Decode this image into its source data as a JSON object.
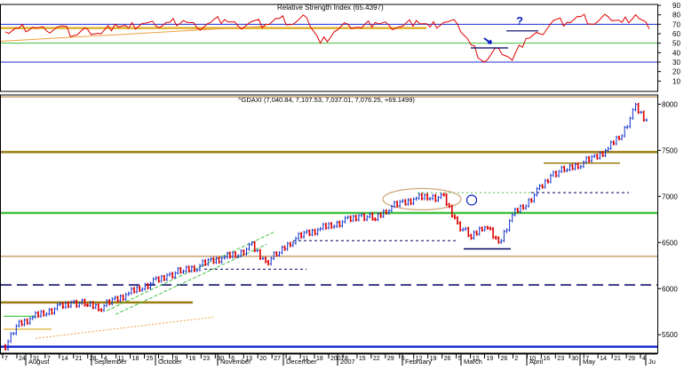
{
  "colors": {
    "background": "#ffffff",
    "frame": "#000000",
    "rsi_line": "#e00000",
    "price_up": "#1030d0",
    "price_down": "#e00000",
    "blue_level": "#1a2fd0",
    "green_level": "#40c040",
    "olive_level": "#9a7d10",
    "tan_level": "#c8a070",
    "orange_trend": "#f0a040",
    "gold_line": "#e0b030",
    "navy_dash": "#000060",
    "annotation_blue": "#1020c0"
  },
  "chart_data": [
    {
      "type": "line",
      "title": "Relative Strength Index (65.4397)",
      "ylim": [
        0,
        90
      ],
      "yticks": [
        "10",
        "20",
        "30",
        "40",
        "50",
        "60",
        "70",
        "80",
        "90"
      ],
      "reference_lines": [
        30,
        50,
        70
      ],
      "annotations": [
        "arrow-icon",
        "question-mark",
        "?"
      ],
      "series": [
        {
          "name": "Relative Strength Index",
          "x_week": [
            0,
            1,
            2,
            3,
            4,
            5,
            6,
            7,
            8,
            9,
            10,
            11,
            12,
            13,
            14,
            15,
            16,
            17,
            18,
            19,
            20,
            21,
            22,
            23,
            24,
            25,
            26,
            27,
            28,
            29,
            30,
            31,
            32,
            33,
            34,
            35,
            36,
            37,
            38,
            39,
            40,
            41,
            42,
            43,
            44,
            45,
            46,
            47
          ],
          "values": [
            62,
            66,
            67,
            63,
            68,
            58,
            65,
            60,
            70,
            66,
            71,
            68,
            72,
            74,
            66,
            72,
            75,
            68,
            73,
            70,
            76,
            70,
            77,
            50,
            62,
            70,
            66,
            72,
            69,
            68,
            74,
            67,
            72,
            70,
            48,
            30,
            45,
            32,
            55,
            60,
            74,
            72,
            78,
            70,
            78,
            72,
            80,
            65
          ]
        }
      ]
    },
    {
      "type": "line",
      "title": "^GDAXI (7,040.84, 7,107.53, 7,037.01, 7,076.25, +69.1499)",
      "ylim": [
        5300,
        8100
      ],
      "yticks": [
        "5500",
        "6000",
        "6500",
        "7000",
        "7500",
        "8000"
      ],
      "x_tick_labels": [
        "7",
        "24",
        "31",
        "7",
        "14",
        "21",
        "28",
        "4",
        "11",
        "18",
        "25",
        "2",
        "9",
        "16",
        "23",
        "30",
        "6",
        "13",
        "20",
        "27",
        "4",
        "11",
        "18",
        "2007",
        "8",
        "15",
        "22",
        "29",
        "5",
        "12",
        "19",
        "26",
        "5",
        "12",
        "19",
        "26",
        "2",
        "10",
        "16",
        "23",
        "30",
        "7",
        "14",
        "21",
        "29",
        "4"
      ],
      "month_labels": [
        "August",
        "September",
        "October",
        "November",
        "December",
        "2007",
        "February",
        "March",
        "April",
        "May",
        "Ju"
      ],
      "horizontal_levels": [
        5370,
        5850,
        6040,
        6350,
        6820,
        7480,
        8080
      ],
      "series": [
        {
          "name": "^GDAXI",
          "x_week": [
            0,
            1,
            2,
            3,
            4,
            5,
            6,
            7,
            8,
            9,
            10,
            11,
            12,
            13,
            14,
            15,
            16,
            17,
            18,
            19,
            20,
            21,
            22,
            23,
            24,
            25,
            26,
            27,
            28,
            29,
            30,
            31,
            32,
            33,
            34,
            35,
            36,
            37,
            38,
            39,
            40,
            41,
            42,
            43,
            44,
            45,
            46,
            47
          ],
          "close": [
            5380,
            5620,
            5690,
            5750,
            5800,
            5850,
            5830,
            5800,
            5880,
            5950,
            6020,
            6080,
            6150,
            6200,
            6240,
            6300,
            6340,
            6380,
            6460,
            6280,
            6400,
            6530,
            6600,
            6650,
            6700,
            6740,
            6790,
            6760,
            6880,
            6930,
            6980,
            7000,
            6980,
            6700,
            6560,
            6700,
            6480,
            6800,
            6920,
            7080,
            7250,
            7300,
            7360,
            7420,
            7520,
            7680,
            7960,
            7780
          ]
        }
      ]
    }
  ]
}
